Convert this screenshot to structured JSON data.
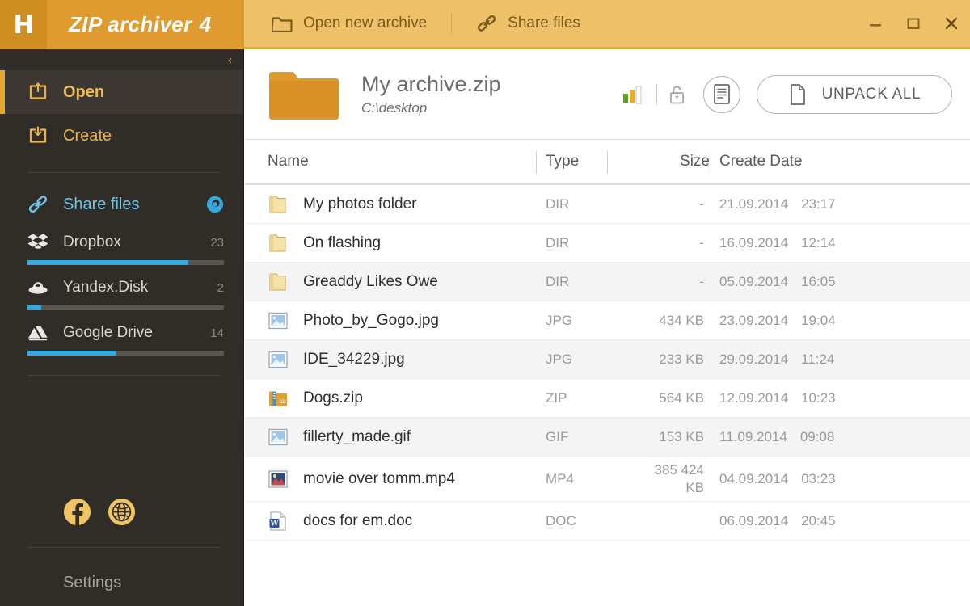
{
  "titlebar": {
    "logo_letter": "H",
    "brand_name": "ZIP archiver",
    "brand_version": "4",
    "buttons": [
      {
        "label": "Open new archive",
        "icon": "folder-icon"
      },
      {
        "label": "Share files",
        "icon": "link-icon"
      }
    ],
    "window_controls": [
      {
        "name": "minimize",
        "glyph": "–"
      },
      {
        "name": "maximize",
        "glyph": "□"
      },
      {
        "name": "close",
        "glyph": "✕"
      }
    ]
  },
  "sidebar": {
    "collapse_glyph": "‹",
    "nav": [
      {
        "label": "Open",
        "icon": "open-archive-icon",
        "active": true
      },
      {
        "label": "Create",
        "icon": "create-archive-icon",
        "active": false
      }
    ],
    "share": {
      "label": "Share files",
      "icon": "link-icon",
      "settings_icon": "gear-icon"
    },
    "clouds": [
      {
        "label": "Dropbox",
        "count": "23",
        "percent": 82,
        "icon": "dropbox-icon"
      },
      {
        "label": "Yandex.Disk",
        "count": "2",
        "percent": 7,
        "icon": "yandex-disk-icon"
      },
      {
        "label": "Google Drive",
        "count": "14",
        "percent": 45,
        "icon": "google-drive-icon"
      }
    ],
    "social": [
      {
        "name": "facebook-icon"
      },
      {
        "name": "globe-icon"
      }
    ],
    "settings_label": "Settings"
  },
  "main": {
    "archive": {
      "name": "My archive.zip",
      "path": "C:\\desktop",
      "folder_icon": "folder-icon"
    },
    "tools": {
      "chart_icon": "bar-chart-icon",
      "lock_icon": "unlock-icon",
      "info_icon": "document-info-icon",
      "unpack_label": "UNPACK ALL",
      "unpack_icon": "file-icon"
    },
    "columns": [
      "Name",
      "Type",
      "Size",
      "Create Date"
    ],
    "files": [
      {
        "name": "My photos folder",
        "type": "DIR",
        "size": "-",
        "date": "21.09.2014",
        "time": "23:17",
        "icon": "folder-icon",
        "alt": false
      },
      {
        "name": "On flashing",
        "type": "DIR",
        "size": "-",
        "date": "16.09.2014",
        "time": "12:14",
        "icon": "folder-icon",
        "alt": false
      },
      {
        "name": "Greaddy Likes Owe",
        "type": "DIR",
        "size": "-",
        "date": "05.09.2014",
        "time": "16:05",
        "icon": "folder-icon",
        "alt": true
      },
      {
        "name": "Photo_by_Gogo.jpg",
        "type": "JPG",
        "size": "434 KB",
        "date": "23.09.2014",
        "time": "19:04",
        "icon": "image-icon",
        "alt": false
      },
      {
        "name": "IDE_34229.jpg",
        "type": "JPG",
        "size": "233 KB",
        "date": "29.09.2014",
        "time": "11:24",
        "icon": "image-icon",
        "alt": true
      },
      {
        "name": "Dogs.zip",
        "type": "ZIP",
        "size": "564 KB",
        "date": "12.09.2014",
        "time": "10:23",
        "icon": "zip-icon",
        "alt": false
      },
      {
        "name": "fillerty_made.gif",
        "type": "GIF",
        "size": "153 KB",
        "date": "11.09.2014",
        "time": "09:08",
        "icon": "image-icon",
        "alt": true
      },
      {
        "name": "movie over tomm.mp4",
        "type": "MP4",
        "size": "385 424 KB",
        "date": "04.09.2014",
        "time": "03:23",
        "icon": "video-icon",
        "alt": false
      },
      {
        "name": "docs for em.doc",
        "type": "DOC",
        "size": "",
        "date": "06.09.2014",
        "time": "20:45",
        "icon": "word-icon",
        "alt": false
      }
    ]
  },
  "colors": {
    "brand_orange": "#e09b30",
    "toolbar_gold": "#eec168",
    "sidebar_dark": "#302c28",
    "accent_blue": "#35a8e0",
    "nav_gold": "#e7b34a"
  }
}
